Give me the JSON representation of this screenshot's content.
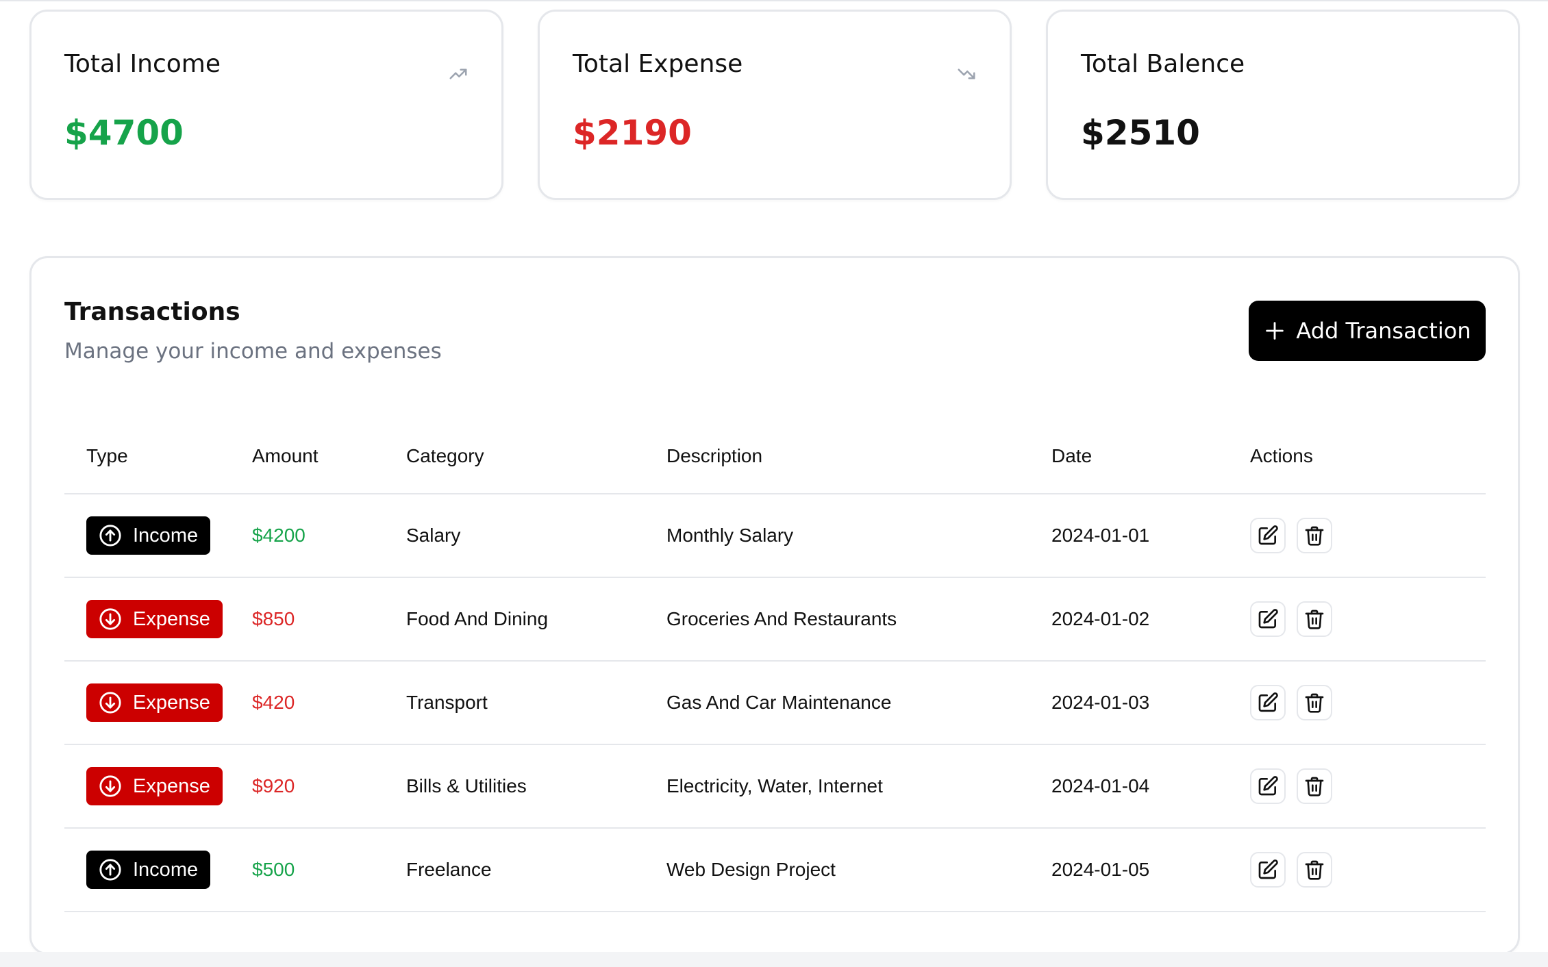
{
  "summary": {
    "income": {
      "title": "Total Income",
      "value": "$4700",
      "color": "#16a34a",
      "icon": "trending-up-icon"
    },
    "expense": {
      "title": "Total Expense",
      "value": "$2190",
      "color": "#dc2626",
      "icon": "trending-down-icon"
    },
    "balance": {
      "title": "Total Balence",
      "value": "$2510",
      "color": "#111111"
    }
  },
  "transactions": {
    "title": "Transactions",
    "subtitle": "Manage your income and expenses",
    "add_button_label": "Add Transaction",
    "columns": [
      "Type",
      "Amount",
      "Category",
      "Description",
      "Date",
      "Actions"
    ],
    "rows": [
      {
        "type": "Income",
        "kind": "income",
        "amount": "$4200",
        "category": "Salary",
        "description": "Monthly Salary",
        "date": "2024-01-01"
      },
      {
        "type": "Expense",
        "kind": "expense",
        "amount": "$850",
        "category": "Food And Dining",
        "description": "Groceries And Restaurants",
        "date": "2024-01-02"
      },
      {
        "type": "Expense",
        "kind": "expense",
        "amount": "$420",
        "category": "Transport",
        "description": "Gas And Car Maintenance",
        "date": "2024-01-03"
      },
      {
        "type": "Expense",
        "kind": "expense",
        "amount": "$920",
        "category": "Bills & Utilities",
        "description": "Electricity, Water, Internet",
        "date": "2024-01-04"
      },
      {
        "type": "Income",
        "kind": "income",
        "amount": "$500",
        "category": "Freelance",
        "description": "Web Design Project",
        "date": "2024-01-05"
      }
    ]
  },
  "colors": {
    "income": "#16a34a",
    "expense": "#dc2626",
    "expense_badge": "#cc0000",
    "income_badge": "#000000",
    "muted": "#6b7280",
    "border": "#e5e7eb"
  }
}
